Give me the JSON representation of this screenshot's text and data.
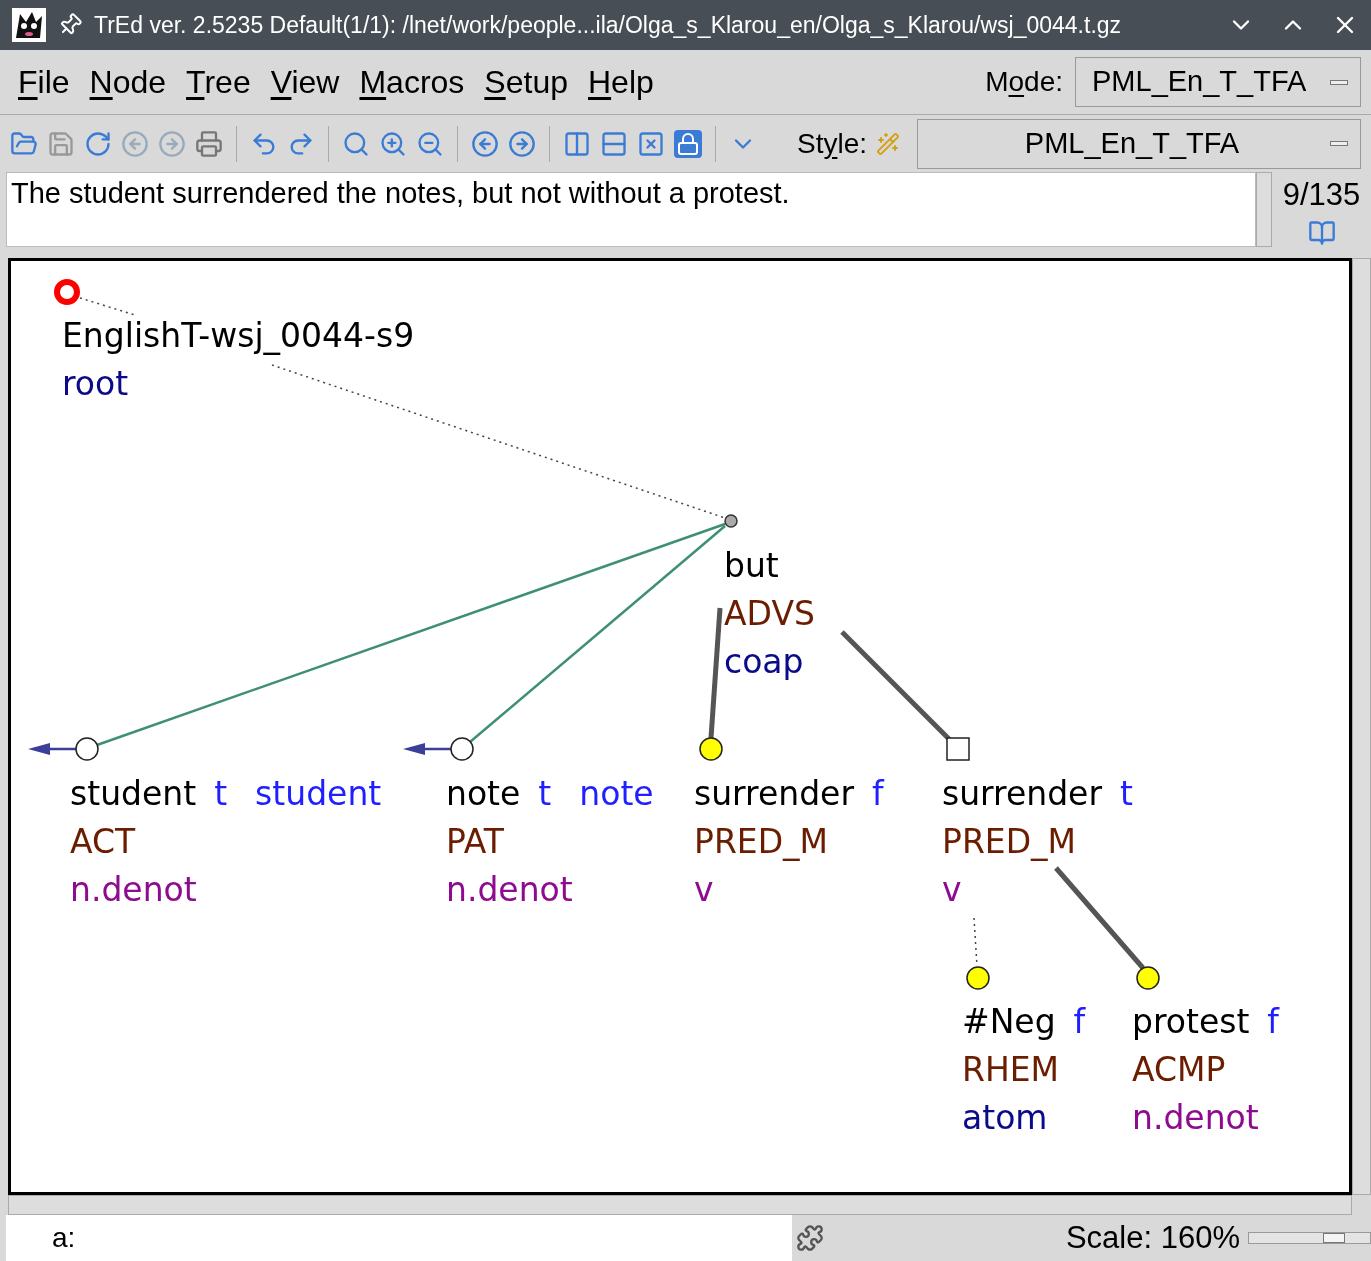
{
  "window": {
    "title": "TrEd ver. 2.5235 Default(1/1): /lnet/work/people...ila/Olga_s_Klarou_en/Olga_s_Klarou/wsj_0044.t.gz"
  },
  "menu": [
    {
      "key": "F",
      "post": "ile"
    },
    {
      "key": "N",
      "post": "ode"
    },
    {
      "key": "T",
      "post": "ree"
    },
    {
      "key": "V",
      "post": "iew"
    },
    {
      "key": "M",
      "post": "acros"
    },
    {
      "key": "S",
      "post": "etup"
    },
    {
      "key": "H",
      "post": "elp"
    }
  ],
  "mode": {
    "label": {
      "pre": "M",
      "key": "o",
      "post": "de:"
    },
    "value": "PML_En_T_TFA"
  },
  "style": {
    "label": {
      "pre": "St",
      "key": "y",
      "post": "le:"
    },
    "value": "PML_En_T_TFA"
  },
  "sentence": "The student surrendered the notes, but not without a protest.",
  "tree_counter": "9/135",
  "tree": {
    "kind": "root",
    "lines": [
      [
        {
          "kind": "id",
          "text": "EnglishT-wsj_0044-s9"
        }
      ],
      [
        {
          "kind": "nodetype",
          "text": "root"
        }
      ]
    ],
    "children": [
      {
        "kind": "coap",
        "dotted_edge": true,
        "lines": [
          [
            {
              "kind": "lemma",
              "text": "but"
            }
          ],
          [
            {
              "kind": "functor",
              "text": "ADVS"
            }
          ],
          [
            {
              "kind": "nodetype",
              "text": "coap"
            }
          ]
        ],
        "children": [
          {
            "kind": "circle",
            "dotted_edge": false,
            "member_edge": false,
            "coref": true,
            "lines": [
              [
                {
                  "kind": "lemma",
                  "text": "student"
                },
                {
                  "kind": "tfa",
                  "text": "t"
                },
                {
                  "kind": "coref",
                  "text": "student"
                }
              ],
              [
                {
                  "kind": "functor",
                  "text": "ACT"
                }
              ],
              [
                {
                  "kind": "sempos",
                  "text": "n.denot"
                }
              ]
            ]
          },
          {
            "kind": "circle",
            "dotted_edge": false,
            "member_edge": false,
            "coref": true,
            "lines": [
              [
                {
                  "kind": "lemma",
                  "text": "note"
                },
                {
                  "kind": "tfa",
                  "text": "t"
                },
                {
                  "kind": "coref",
                  "text": "note"
                }
              ],
              [
                {
                  "kind": "functor",
                  "text": "PAT"
                }
              ],
              [
                {
                  "kind": "sempos",
                  "text": "n.denot"
                }
              ]
            ]
          },
          {
            "kind": "filled",
            "dotted_edge": false,
            "member_edge": true,
            "coref": false,
            "lines": [
              [
                {
                  "kind": "lemma",
                  "text": "surrender"
                },
                {
                  "kind": "tfa",
                  "text": "f"
                }
              ],
              [
                {
                  "kind": "functor",
                  "text": "PRED_M"
                }
              ],
              [
                {
                  "kind": "sempos",
                  "text": "v"
                }
              ]
            ]
          },
          {
            "kind": "square",
            "dotted_edge": false,
            "member_edge": true,
            "coref": false,
            "lines": [
              [
                {
                  "kind": "lemma",
                  "text": "surrender"
                },
                {
                  "kind": "tfa",
                  "text": "t"
                }
              ],
              [
                {
                  "kind": "functor",
                  "text": "PRED_M"
                }
              ],
              [
                {
                  "kind": "sempos",
                  "text": "v"
                }
              ]
            ],
            "children": [
              {
                "kind": "filled",
                "dotted_edge": true,
                "coref": false,
                "lines": [
                  [
                    {
                      "kind": "lemma",
                      "text": "#Neg"
                    },
                    {
                      "kind": "tfa",
                      "text": "f"
                    }
                  ],
                  [
                    {
                      "kind": "functor",
                      "text": "RHEM"
                    }
                  ],
                  [
                    {
                      "kind": "nodetype",
                      "text": "atom"
                    }
                  ]
                ]
              },
              {
                "kind": "filled",
                "dotted_edge": false,
                "member_edge": true,
                "coref": false,
                "lines": [
                  [
                    {
                      "kind": "lemma",
                      "text": "protest"
                    },
                    {
                      "kind": "tfa",
                      "text": "f"
                    }
                  ],
                  [
                    {
                      "kind": "functor",
                      "text": "ACMP"
                    }
                  ],
                  [
                    {
                      "kind": "sempos",
                      "text": "n.denot"
                    }
                  ]
                ]
              }
            ]
          }
        ]
      }
    ]
  },
  "command_field": {
    "value": "a:"
  },
  "scale": {
    "label": "Scale: 160%",
    "level": 0.7
  }
}
